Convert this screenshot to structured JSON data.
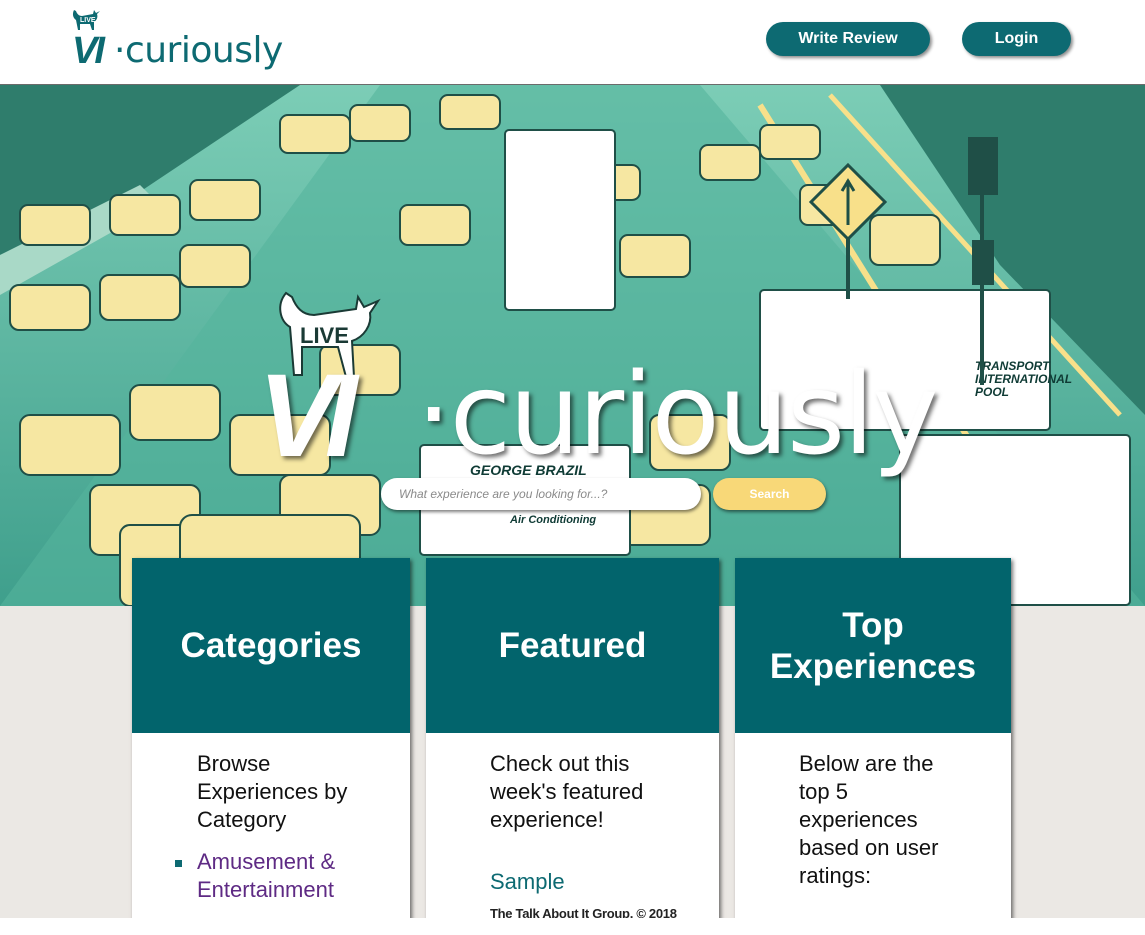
{
  "header": {
    "logo_badge": "LIVE",
    "logo_vi": "VI",
    "logo_word": "·curiously",
    "write_review_label": "Write Review",
    "login_label": "Login"
  },
  "hero": {
    "logo_badge": "LIVE",
    "logo_vi": "VI",
    "logo_word": "·curiously",
    "search_placeholder": "What experience are you looking for...?",
    "search_label": "Search"
  },
  "cards": {
    "categories": {
      "title": "Categories",
      "text": "Browse Experiences by Category",
      "items": [
        "Amusement & Entertainment"
      ]
    },
    "featured": {
      "title": "Featured",
      "text": "Check out this week's featured experience!",
      "link": "Sample"
    },
    "top": {
      "title": "Top Experiences",
      "text": "Below are the top 5 experiences based on user ratings:"
    }
  },
  "footer": {
    "text": "The Talk About It Group, © 2018"
  },
  "colors": {
    "brand": "#02646c",
    "accent": "#f8d878",
    "link": "#5e2a84"
  }
}
